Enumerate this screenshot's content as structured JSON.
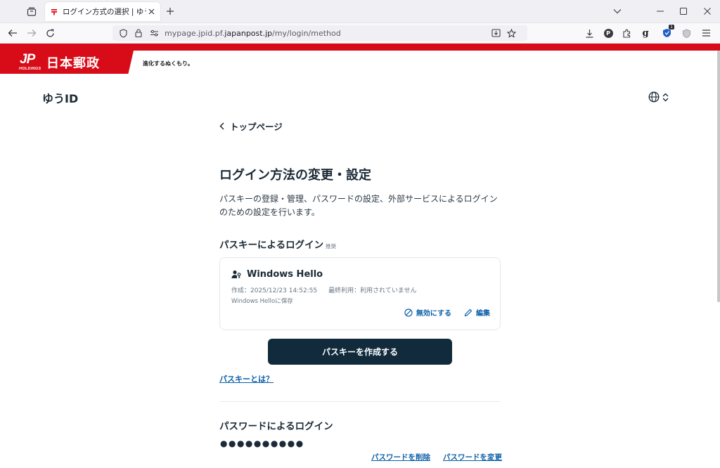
{
  "browser": {
    "tab": {
      "title": "ログイン方式の選択 | ゆうID"
    },
    "url": {
      "prefix": "mypage.jpid.pf.",
      "host": "japanpost.jp",
      "path": "/my/login/method"
    },
    "extensions": {
      "p_label": "P",
      "g_label": "g",
      "badge": "1"
    }
  },
  "header": {
    "logo_jp": "JP",
    "logo_holdings": "HOLDINGS",
    "logo_text": "日本郵政",
    "tagline": "進化するぬくもり。",
    "service_name": "ゆうID"
  },
  "main": {
    "back_label": "トップページ",
    "title": "ログイン方法の変更・設定",
    "description": "パスキーの登録・管理、パスワードの設定、外部サービスによるログインのための設定を行います。",
    "passkey_section": {
      "title": "パスキーによるログイン",
      "recommend": "推奨",
      "card": {
        "name": "Windows Hello",
        "created": "作成：2025/12/23 14:52:55",
        "last_used": "最終利用：利用されていません",
        "storage": "Windows Helloに保存",
        "disable_label": "無効にする",
        "edit_label": "編集"
      },
      "create_button": "パスキーを作成する",
      "help_link": "パスキーとは？"
    },
    "password_section": {
      "title": "パスワードによるログイン",
      "masked": "●●●●●●●●●●",
      "delete_label": "パスワードを削除",
      "change_label": "パスワードを変更"
    }
  },
  "colors": {
    "brand_red": "#d80c18",
    "navy": "#112b3c",
    "link_blue": "#0c5fa8"
  }
}
